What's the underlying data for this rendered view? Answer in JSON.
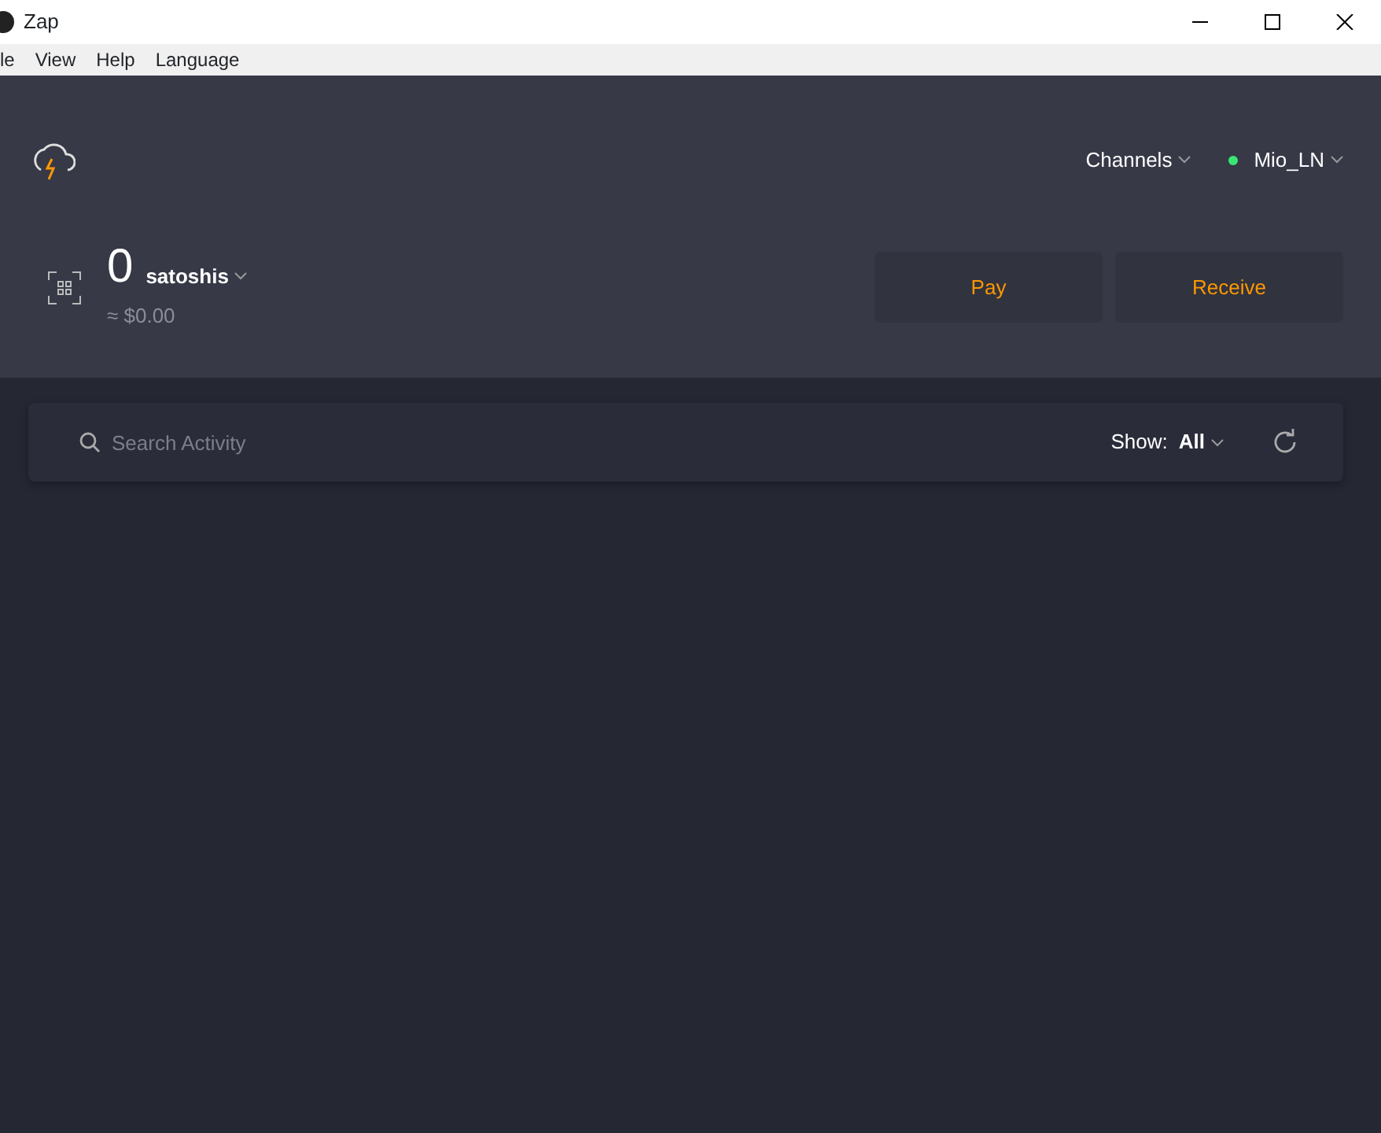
{
  "window": {
    "title": "Zap"
  },
  "menu": [
    "le",
    "View",
    "Help",
    "Language"
  ],
  "header": {
    "channels": "Channels",
    "node": {
      "name": "Mio_LN",
      "color": "#39e673"
    }
  },
  "balance": {
    "amount": "0",
    "unit": "satoshis",
    "fiat": "≈ $0.00"
  },
  "buttons": [
    {
      "label": "Pay"
    },
    {
      "label": "Receive"
    }
  ],
  "activity": {
    "search": {
      "placeholder": "Search Activity"
    },
    "show_label": "Show:",
    "show_value": "All"
  }
}
